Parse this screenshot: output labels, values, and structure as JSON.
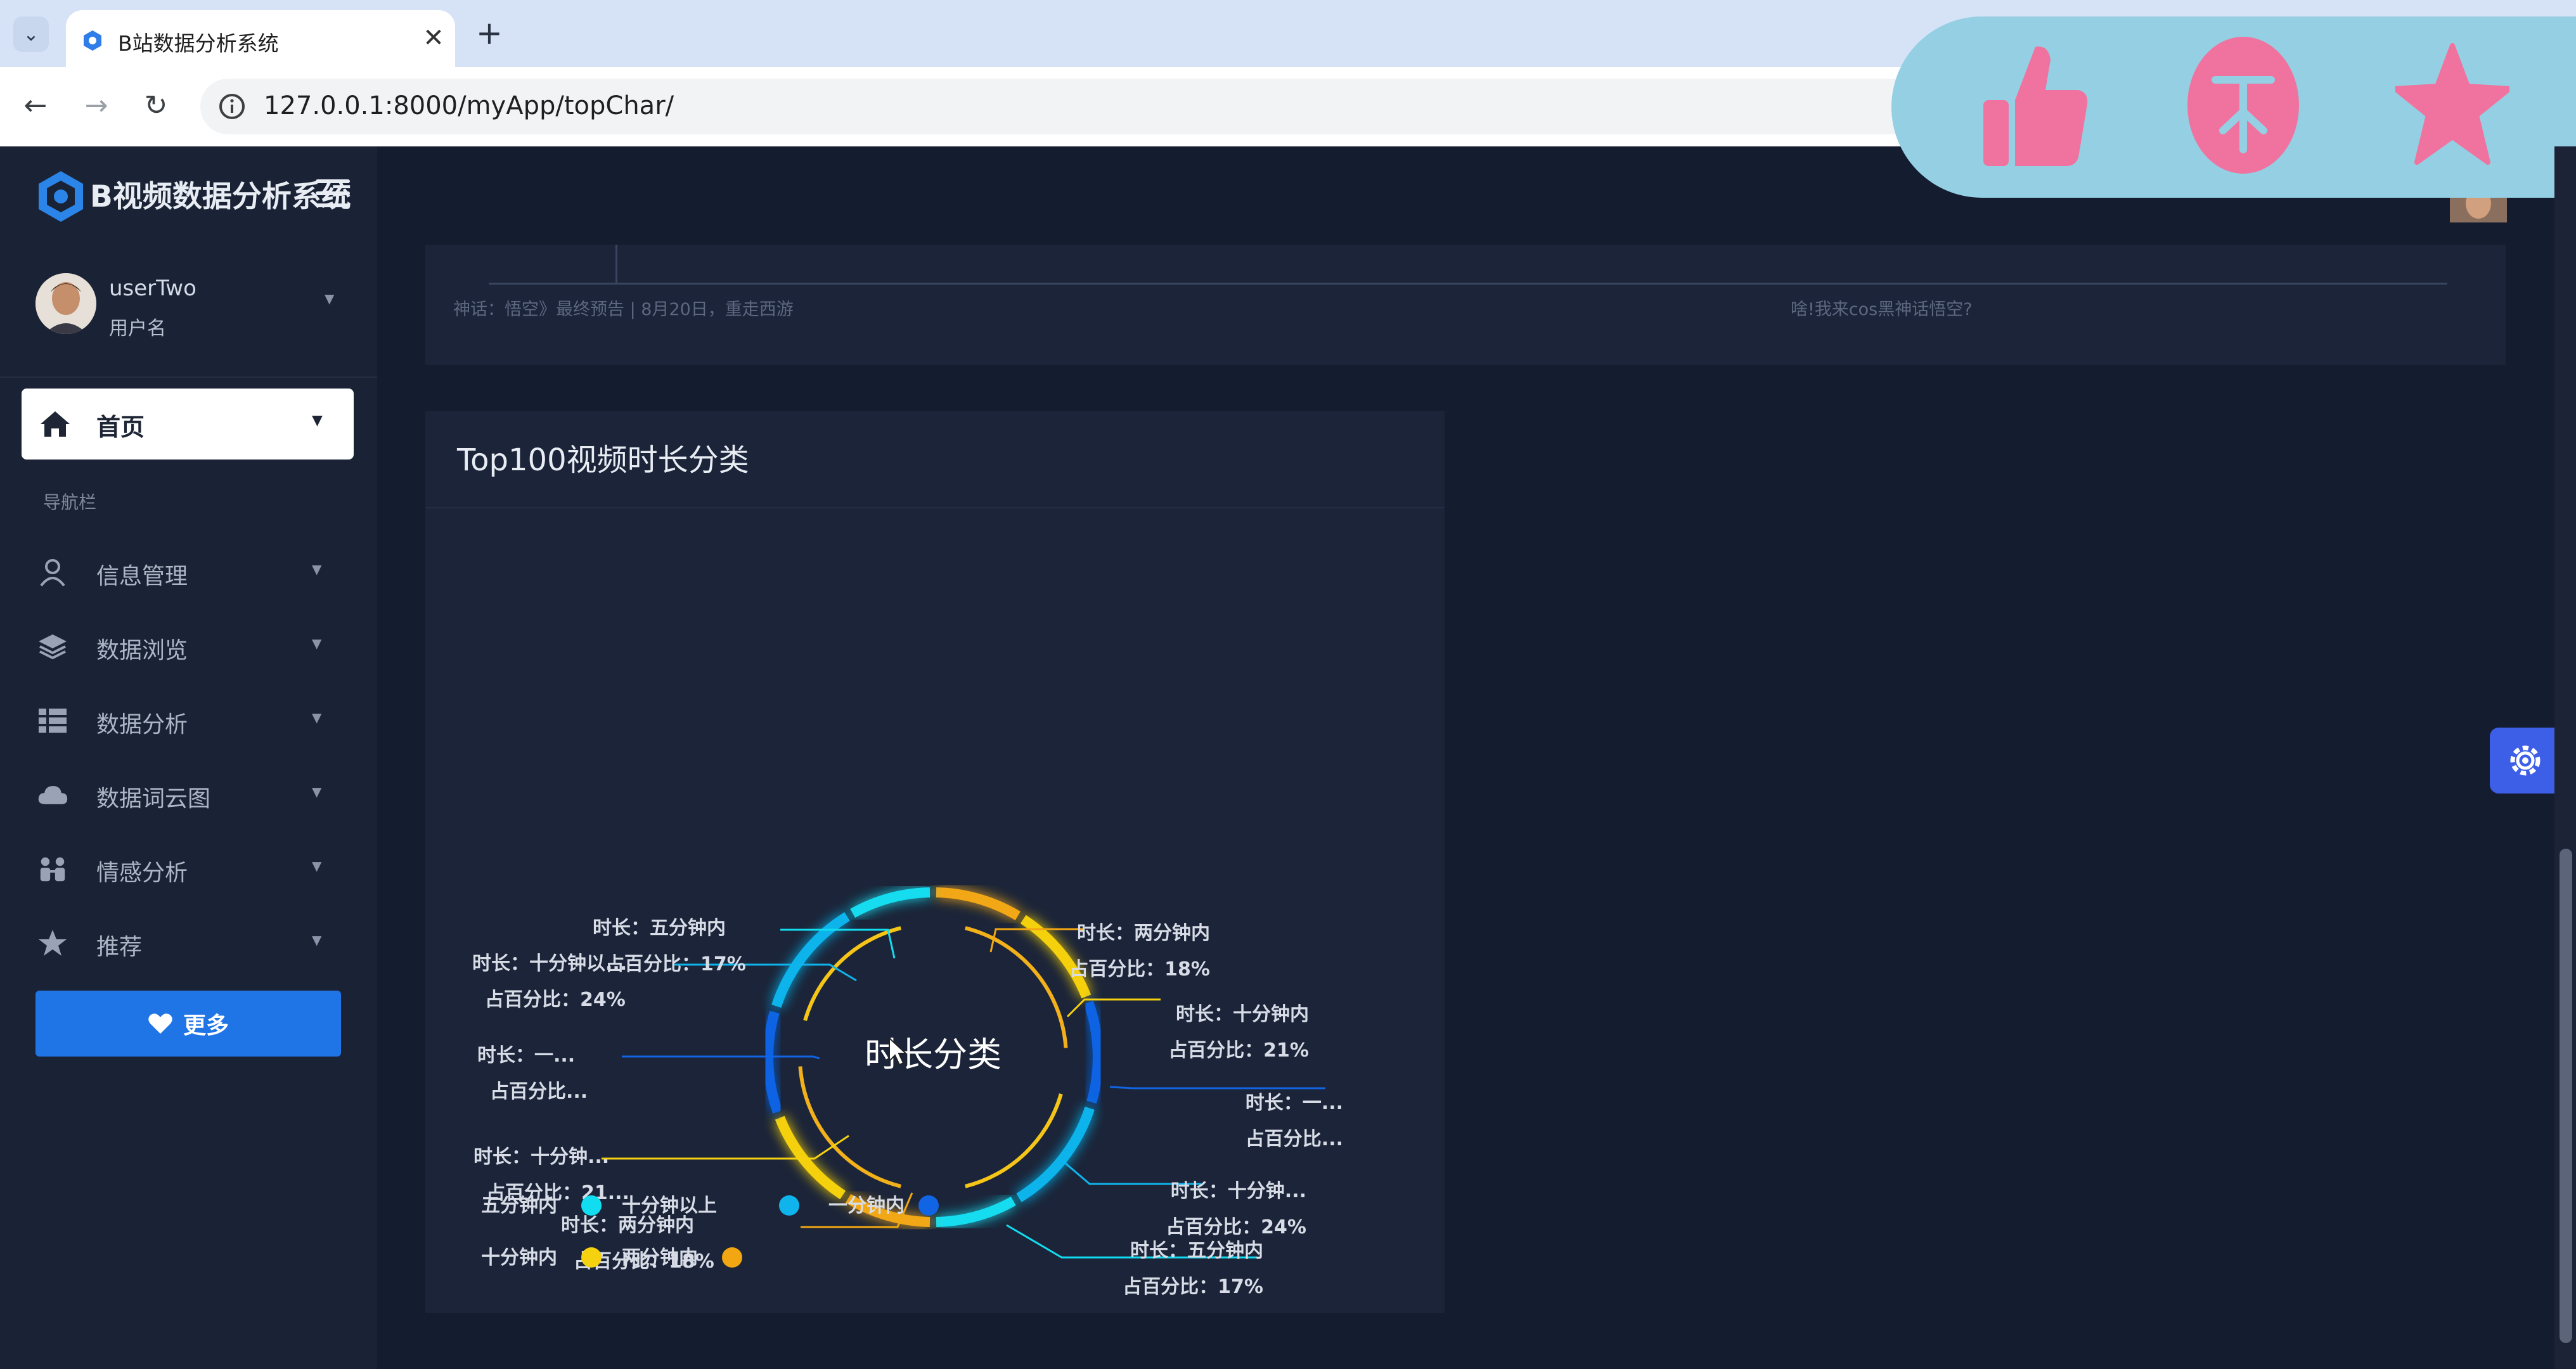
{
  "browser": {
    "tab_title": "B站数据分析系统",
    "close_glyph": "✕",
    "new_tab_glyph": "+",
    "dropdown_glyph": "⌄",
    "back_glyph": "←",
    "forward_glyph": "→",
    "reload_glyph": "↻",
    "url": "127.0.0.1:8000/myApp/topChar/"
  },
  "sidebar": {
    "brand": "B视频数据分析系统",
    "user": {
      "name": "userTwo",
      "role": "用户名"
    },
    "home_label": "首页",
    "section_label": "导航栏",
    "items": [
      {
        "label": "信息管理",
        "icon": "user-icon"
      },
      {
        "label": "数据浏览",
        "icon": "layers-icon"
      },
      {
        "label": "数据分析",
        "icon": "table-icon"
      },
      {
        "label": "数据词云图",
        "icon": "cloud-icon"
      },
      {
        "label": "情感分析",
        "icon": "people-icon"
      },
      {
        "label": "推荐",
        "icon": "star-icon"
      }
    ],
    "more_label": "更多",
    "caret": "▼"
  },
  "top_panel": {
    "left_text": "神话：悟空》最终预告 | 8月20日，重走西游",
    "right_text": "啥!我来cos黑神话悟空?"
  },
  "chart_panel": {
    "title": "Top100视频时长分类"
  },
  "chart_data": {
    "type": "pie",
    "title": "时长分类",
    "categories": [
      "五分钟内",
      "十分钟以上",
      "一分钟内",
      "十分钟内",
      "两分钟内"
    ],
    "values": [
      17,
      24,
      21,
      21,
      18
    ],
    "colors": [
      "#12dcef",
      "#0fb4ec",
      "#1164e3",
      "#f5d10f",
      "#f2a712"
    ],
    "legend_position": "bottom-left",
    "labels": [
      {
        "name": "时长：五分钟内",
        "pct": "占百分比：17%"
      },
      {
        "name": "时长：十分钟以...",
        "pct": "占百分比：24%"
      },
      {
        "name": "时长：一...",
        "pct": "占百分比..."
      },
      {
        "name": "时长：十分钟...",
        "pct": "占百分比：21..."
      },
      {
        "name": "时长：两分钟内",
        "pct": "占百分比：18%"
      },
      {
        "name": "时长：两分钟内",
        "pct": "占百分比：18%"
      },
      {
        "name": "时长：十分钟内",
        "pct": "占百分比：21%"
      },
      {
        "name": "时长：一...",
        "pct": "占百分比..."
      },
      {
        "name": "时长：十分钟...",
        "pct": "占百分比：24%"
      },
      {
        "name": "时长：五分钟内",
        "pct": "占百分比：17%"
      }
    ]
  },
  "colors": {
    "page_bg": "#141c2f",
    "sidebar_bg": "#1a2336",
    "panel_bg": "#1b2438",
    "accent": "#1f74e6",
    "reaction_pink": "#f0739f"
  }
}
